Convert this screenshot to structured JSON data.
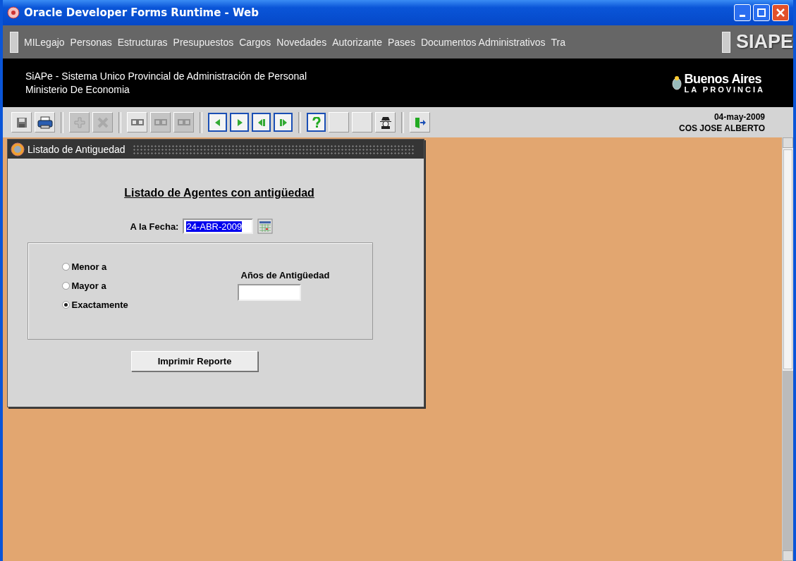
{
  "window": {
    "title": "Oracle Developer Forms Runtime - Web"
  },
  "menu": {
    "items": [
      {
        "label": "MILegajo"
      },
      {
        "label": "Personas"
      },
      {
        "label": "Estructuras"
      },
      {
        "label": "Presupuestos"
      },
      {
        "label": "Cargos"
      },
      {
        "label": "Novedades"
      },
      {
        "label": "Autorizante"
      },
      {
        "label": "Pases"
      },
      {
        "label": "Documentos Administrativos"
      },
      {
        "label": "Tra"
      }
    ],
    "brand": "SIAPE"
  },
  "banner": {
    "line_1": "SiAPe - Sistema Unico Provincial de Administración de Personal",
    "line_2": "Ministerio De Economia",
    "logo_title": "Buenos Aires",
    "logo_subtitle": "LA PROVINCIA"
  },
  "toolbar": {
    "buttons": [
      {
        "kind": "save",
        "disabled": false
      },
      {
        "kind": "print",
        "disabled": false
      },
      {
        "kind": "separator"
      },
      {
        "kind": "add",
        "disabled": true
      },
      {
        "kind": "delete",
        "disabled": true
      },
      {
        "kind": "separator"
      },
      {
        "kind": "record",
        "disabled": false
      },
      {
        "kind": "record",
        "disabled": true
      },
      {
        "kind": "record",
        "disabled": true
      },
      {
        "kind": "separator"
      },
      {
        "kind": "prev",
        "disabled": false
      },
      {
        "kind": "next",
        "disabled": false
      },
      {
        "kind": "first",
        "disabled": false
      },
      {
        "kind": "last",
        "disabled": false
      },
      {
        "kind": "separator"
      },
      {
        "kind": "help",
        "disabled": false
      },
      {
        "kind": "blank",
        "disabled": false
      },
      {
        "kind": "blank",
        "disabled": false
      },
      {
        "kind": "spy",
        "disabled": false
      },
      {
        "kind": "separator"
      },
      {
        "kind": "exit",
        "disabled": false
      }
    ],
    "date": "04-may-2009",
    "user": "COS JOSE ALBERTO"
  },
  "form": {
    "title": "Listado de Antiguedad",
    "heading": "Listado de Agentes con antigüedad",
    "date_label": "A la Fecha:",
    "date_value": "24-ABR-2009",
    "date_highlighted": true,
    "options": [
      {
        "label": "Menor a",
        "selected": false
      },
      {
        "label": "Mayor a",
        "selected": false
      },
      {
        "label": "Exactamente",
        "selected": true
      }
    ],
    "years_label": "Años de Antigüedad",
    "button": "Imprimir Reporte"
  }
}
